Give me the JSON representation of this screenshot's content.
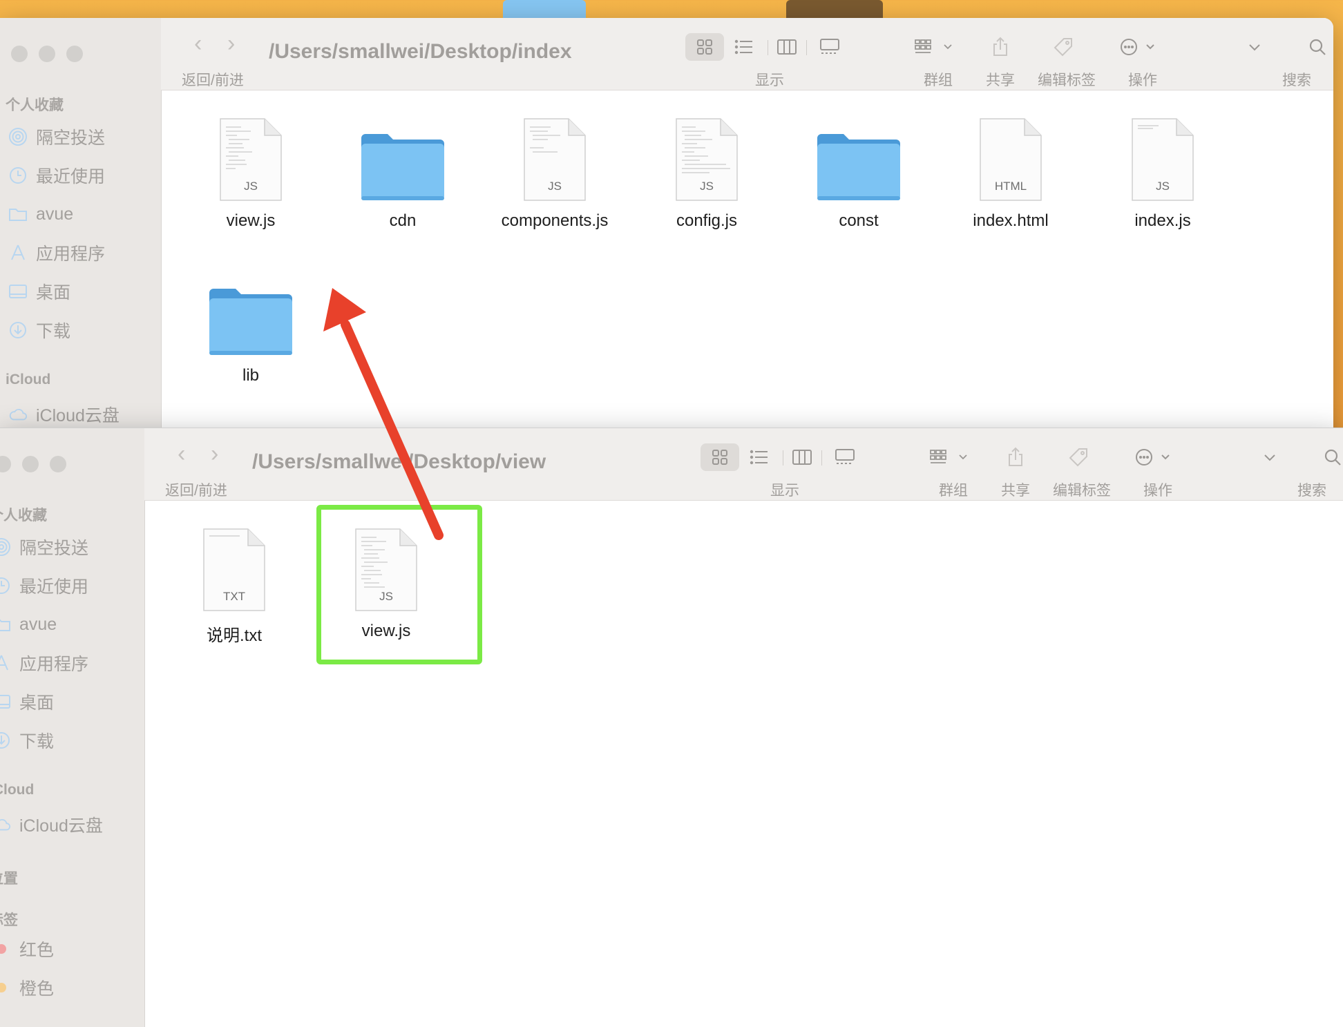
{
  "windows": {
    "index": {
      "path": "/Users/smallwei/Desktop/index",
      "nav_label": "返回/前进",
      "toolbar": {
        "view": "显示",
        "group": "群组",
        "share": "共享",
        "tags": "编辑标签",
        "action": "操作",
        "search": "搜索"
      },
      "sidebar": {
        "favorites_header": "个人收藏",
        "items": [
          {
            "label": "隔空投送",
            "icon": "airdrop-icon"
          },
          {
            "label": "最近使用",
            "icon": "clock-icon"
          },
          {
            "label": "avue",
            "icon": "folder-icon"
          },
          {
            "label": "应用程序",
            "icon": "applications-icon"
          },
          {
            "label": "桌面",
            "icon": "desktop-icon"
          },
          {
            "label": "下载",
            "icon": "download-icon"
          }
        ],
        "icloud_header": "iCloud",
        "icloud_items": [
          {
            "label": "iCloud云盘",
            "icon": "cloud-icon"
          }
        ]
      },
      "files": [
        {
          "name": "view.js",
          "type": "doc",
          "ext": "JS"
        },
        {
          "name": "cdn",
          "type": "folder"
        },
        {
          "name": "components.js",
          "type": "doc",
          "ext": "JS"
        },
        {
          "name": "config.js",
          "type": "doc",
          "ext": "JS"
        },
        {
          "name": "const",
          "type": "folder"
        },
        {
          "name": "index.html",
          "type": "doc",
          "ext": "HTML"
        },
        {
          "name": "index.js",
          "type": "doc",
          "ext": "JS"
        },
        {
          "name": "lib",
          "type": "folder"
        }
      ]
    },
    "view": {
      "path": "/Users/smallwei/Desktop/view",
      "nav_label": "返回/前进",
      "toolbar": {
        "view": "显示",
        "group": "群组",
        "share": "共享",
        "tags": "编辑标签",
        "action": "操作",
        "search": "搜索"
      },
      "sidebar": {
        "favorites_header": "个人收藏",
        "items": [
          {
            "label": "隔空投送",
            "icon": "airdrop-icon"
          },
          {
            "label": "最近使用",
            "icon": "clock-icon"
          },
          {
            "label": "avue",
            "icon": "folder-icon"
          },
          {
            "label": "应用程序",
            "icon": "applications-icon"
          },
          {
            "label": "桌面",
            "icon": "desktop-icon"
          },
          {
            "label": "下载",
            "icon": "download-icon"
          }
        ],
        "icloud_header": "iCloud",
        "icloud_items": [
          {
            "label": "iCloud云盘",
            "icon": "cloud-icon"
          }
        ],
        "locations_header": "位置",
        "tags_header": "标签",
        "tags": [
          {
            "label": "红色",
            "color": "#f26b6b"
          },
          {
            "label": "橙色",
            "color": "#f5b041"
          }
        ]
      },
      "files": [
        {
          "name": "说明.txt",
          "type": "doc",
          "ext": "TXT"
        },
        {
          "name": "view.js",
          "type": "doc",
          "ext": "JS",
          "highlighted": true
        }
      ]
    }
  },
  "annotation": {
    "arrow_color": "#e8412b",
    "highlight_color": "#7bea45"
  }
}
